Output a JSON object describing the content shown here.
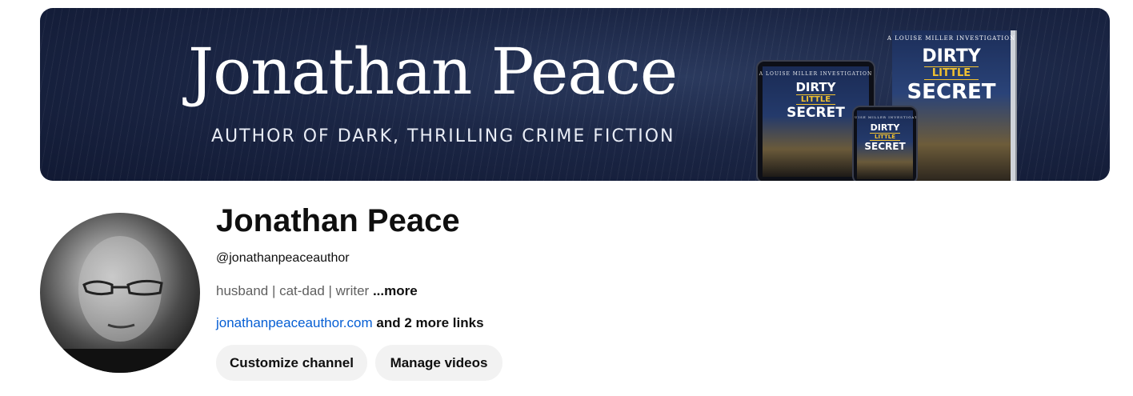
{
  "banner": {
    "title": "Jonathan Peace",
    "tagline": "AUTHOR OF DARK, THRILLING CRIME FICTION",
    "book": {
      "series": "A LOUISE MILLER INVESTIGATION",
      "word1": "DIRTY",
      "word2": "LITTLE",
      "word3": "SECRET"
    }
  },
  "channel": {
    "name": "Jonathan Peace",
    "handle": "@jonathanpeaceauthor",
    "description": "husband | cat-dad | writer",
    "more_label": "...more",
    "link_text": "jonathanpeaceauthor.com",
    "more_links_text": "and 2 more links"
  },
  "buttons": {
    "customize": "Customize channel",
    "manage": "Manage videos"
  },
  "colors": {
    "link": "#065fd4",
    "button_bg": "#f2f2f2",
    "accent_yellow": "#f2c230"
  }
}
